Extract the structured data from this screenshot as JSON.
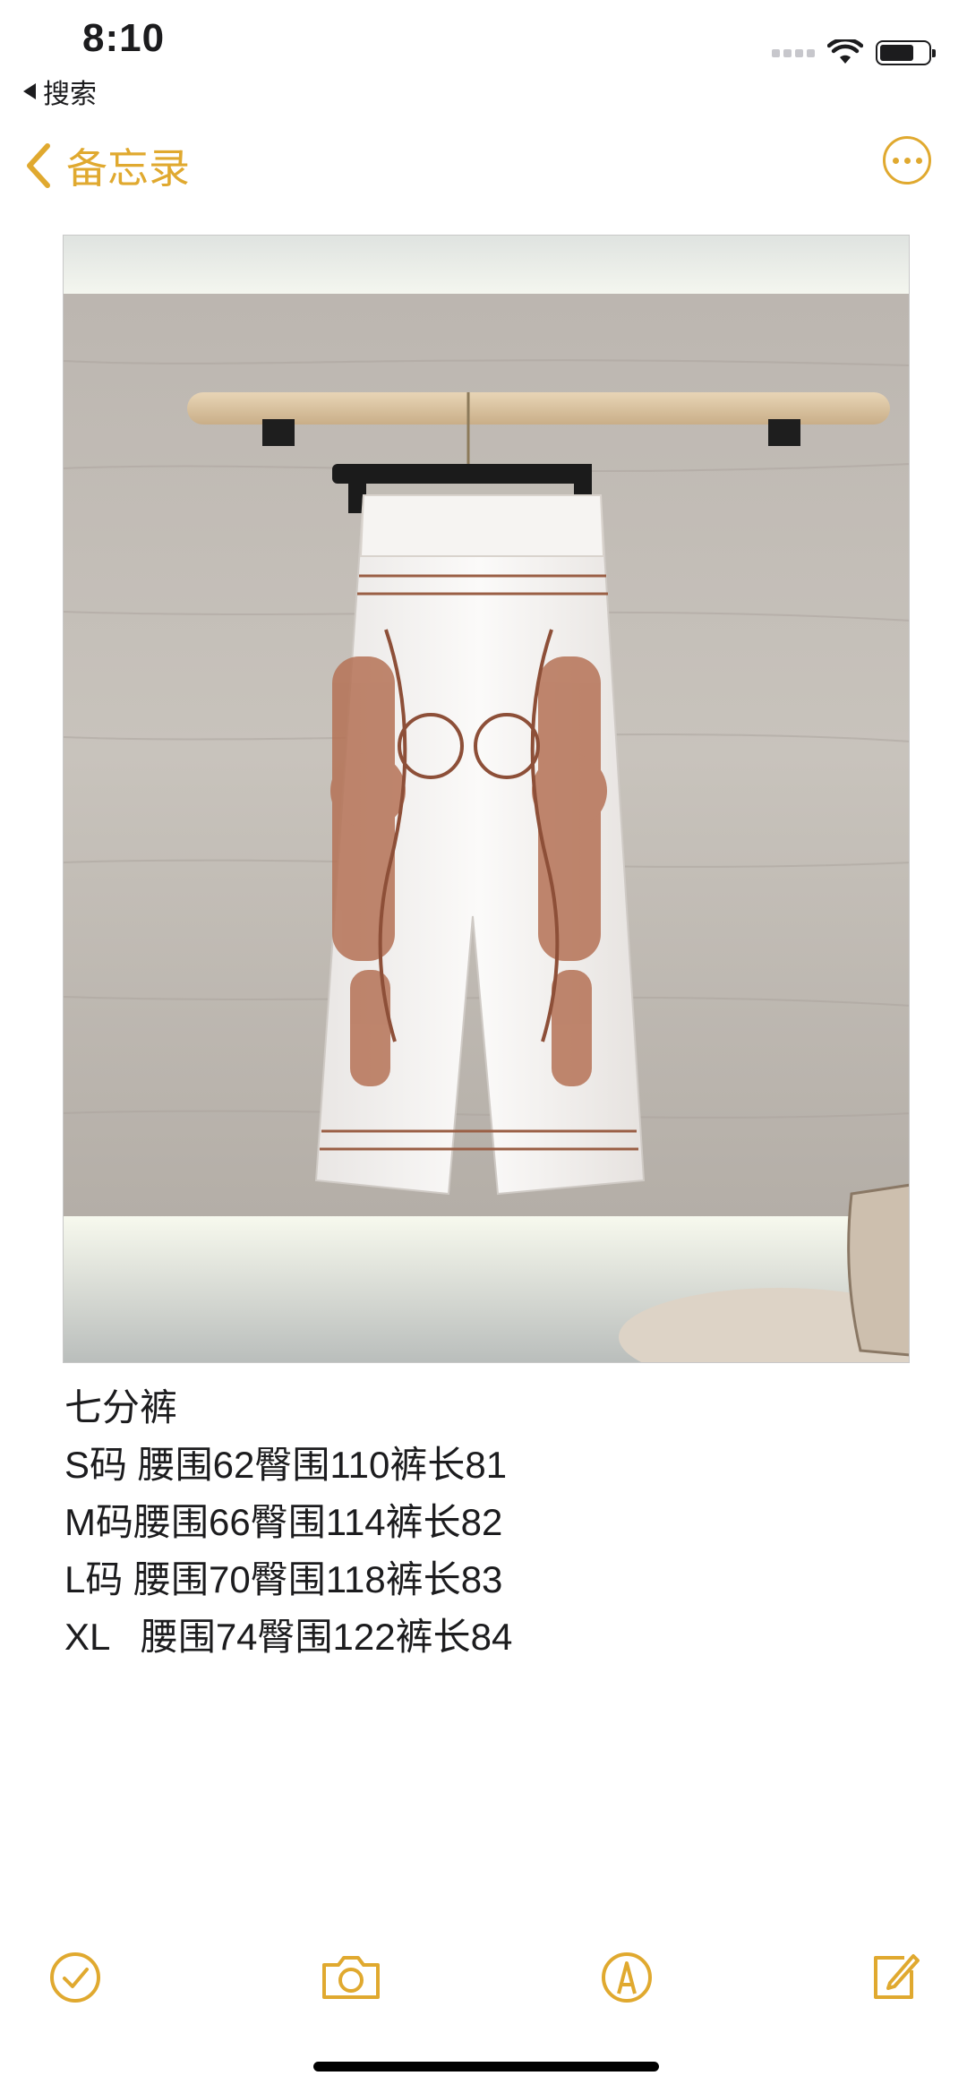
{
  "status_bar": {
    "time": "8:10",
    "back_app_label": "搜索",
    "wifi_icon": "wifi-icon",
    "battery_icon": "battery-icon",
    "battery_level": 0.72
  },
  "nav": {
    "back_label": "备忘录",
    "back_icon": "chevron-left-icon",
    "more_icon": "ellipsis-circle-icon",
    "accent_color": "#e0a92f"
  },
  "note": {
    "photo_icon": "photo",
    "lines": [
      "七分裤",
      "S码 腰围62臀围110裤长81",
      "M码腰围66臀围114裤长82",
      "L码 腰围70臀围118裤长83",
      "XL   腰围74臀围122裤长84"
    ]
  },
  "toolbar": {
    "checklist_icon": "checklist-icon",
    "camera_icon": "camera-icon",
    "markup_icon": "markup-pen-icon",
    "compose_icon": "compose-icon"
  }
}
